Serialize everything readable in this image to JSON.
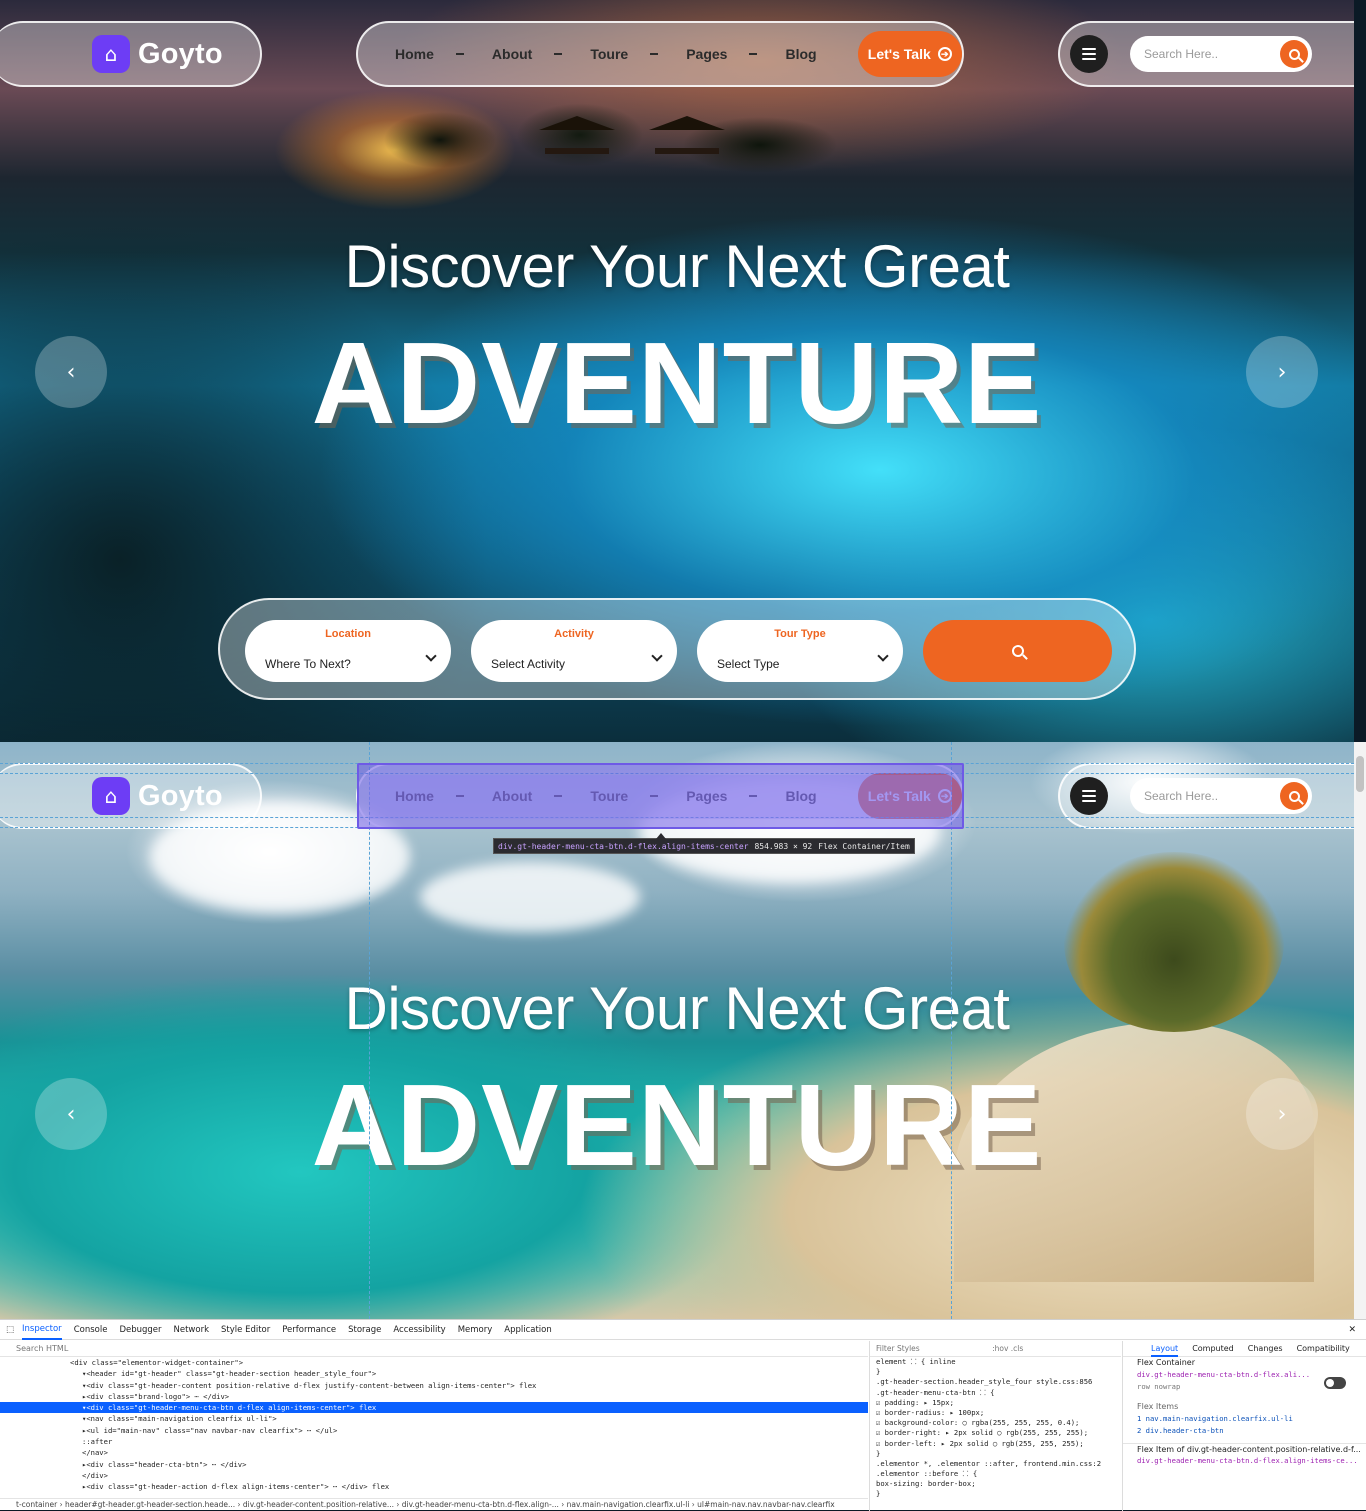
{
  "header": {
    "brand_name": "Goyto",
    "nav": [
      "Home",
      "About",
      "Toure",
      "Pages",
      "Blog"
    ],
    "cta_label": "Let's Talk",
    "search_placeholder": "Search Here..",
    "icons": [
      "map-icon",
      "menu-icon",
      "search-icon",
      "arrow-circle-icon"
    ]
  },
  "hero": {
    "subtitle": "Discover Your Next Great",
    "title": "ADVENTURE",
    "prev_icon": "‹",
    "next_icon": "›"
  },
  "booking": {
    "location": {
      "label": "Location",
      "value": "Where To Next?"
    },
    "activity": {
      "label": "Activity",
      "value": "Select Activity"
    },
    "tour_type": {
      "label": "Tour Type",
      "value": "Select Type"
    }
  },
  "inspector_tooltip": {
    "selector": "div.gt-header-menu-cta-btn.d-flex.align-items-center",
    "size": "854.983 × 92",
    "kind": "Flex Container/Item"
  },
  "devtools": {
    "tabs": [
      "Inspector",
      "Console",
      "Debugger",
      "Network",
      "Style Editor",
      "Performance",
      "Storage",
      "Accessibility",
      "Memory",
      "Application"
    ],
    "search_placeholder": "Search HTML",
    "tree": [
      "<div class=\"elementor-widget-container\">",
      "▾<header id=\"gt-header\" class=\"gt-header-section header_style_four\">",
      "  ▾<div class=\"gt-header-content position-relative d-flex justify-content-between align-items-center\"> flex",
      "    ▸<div class=\"brand-logo\"> ⋯ </div>",
      "    ▾<div class=\"gt-header-menu-cta-btn d-flex align-items-center\"> flex",
      "      ▾<nav class=\"main-navigation clearfix ul-li\">",
      "        ▸<ul id=\"main-nav\" class=\"nav navbar-nav clearfix\"> ⋯ </ul>",
      "          ::after",
      "        </nav>",
      "      ▸<div class=\"header-cta-btn\"> ⋯ </div>",
      "    </div>",
      "    ▸<div class=\"gt-header-action d-flex align-items-center\"> ⋯ </div> flex"
    ],
    "breadcrumbs": "t-container › header#gt-header.gt-header-section.heade... › div.gt-header-content.position-relative... › div.gt-header-menu-cta-btn.d-flex.align-... › nav.main-navigation.clearfix.ul-li › ul#main-nav.nav.navbar-nav.clearfix",
    "rules_filter": "Filter Styles",
    "rules_toggles": ":hov  .cls",
    "rules": [
      "element ⸬ {                              inline",
      "}",
      ".gt-header-section.header_style_four    style.css:856",
      ".gt-header-menu-cta-btn ⸬ {",
      " ☑ padding: ▸ 15px;",
      " ☑ border-radius: ▸ 100px;",
      " ☑ background-color: ◯ rgba(255, 255, 255, 0.4);",
      " ☑ border-right: ▸ 2px solid ◯ rgb(255, 255, 255);",
      " ☑ border-left: ▸ 2px solid ◯ rgb(255, 255, 255);",
      "}",
      ".elementor *, .elementor ::after,   frontend.min.css:2",
      ".elementor ::before ⸬ {",
      "    box-sizing: border-box;",
      "}"
    ],
    "layout_tabs": [
      "Layout",
      "Computed",
      "Changes",
      "Compatibility"
    ],
    "layout": {
      "flex_container": "Flex Container",
      "container_name": "div.gt-header-menu-cta-btn.d-flex.ali...",
      "chips": "row  nowrap",
      "flex_items": "Flex Items",
      "item1": "1  nav.main-navigation.clearfix.ul-li",
      "item2": "2  div.header-cta-btn",
      "flex_item_of": "Flex Item of div.gt-header-content.position-relative.d-f...",
      "item_of_name": "div.gt-header-menu-cta-btn.d-flex.align-items-ce..."
    }
  }
}
